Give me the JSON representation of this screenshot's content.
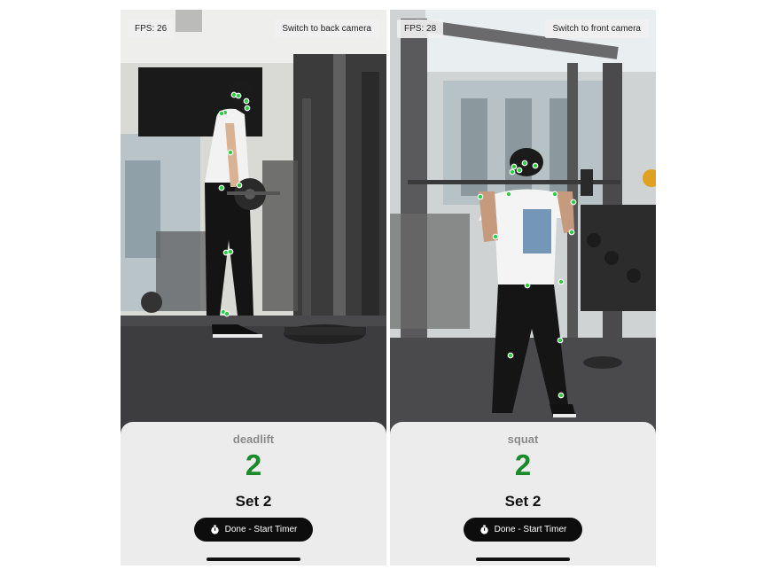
{
  "screens": [
    {
      "fps_label": "FPS: 26",
      "switch_camera_label": "Switch to back camera",
      "exercise_name": "deadlift",
      "rep_count": "2",
      "set_label": "Set 2",
      "done_button_label": "Done - Start Timer",
      "done_button_icon": "timer-icon"
    },
    {
      "fps_label": "FPS: 28",
      "switch_camera_label": "Switch to front camera",
      "exercise_name": "squat",
      "rep_count": "2",
      "set_label": "Set 2",
      "done_button_label": "Done - Start Timer",
      "done_button_icon": "timer-icon"
    }
  ],
  "colors": {
    "keypoint": "#2ecc40",
    "rep_count": "#1a8a2a",
    "panel_bg": "#ececec",
    "button_bg": "#0d0d0d"
  }
}
